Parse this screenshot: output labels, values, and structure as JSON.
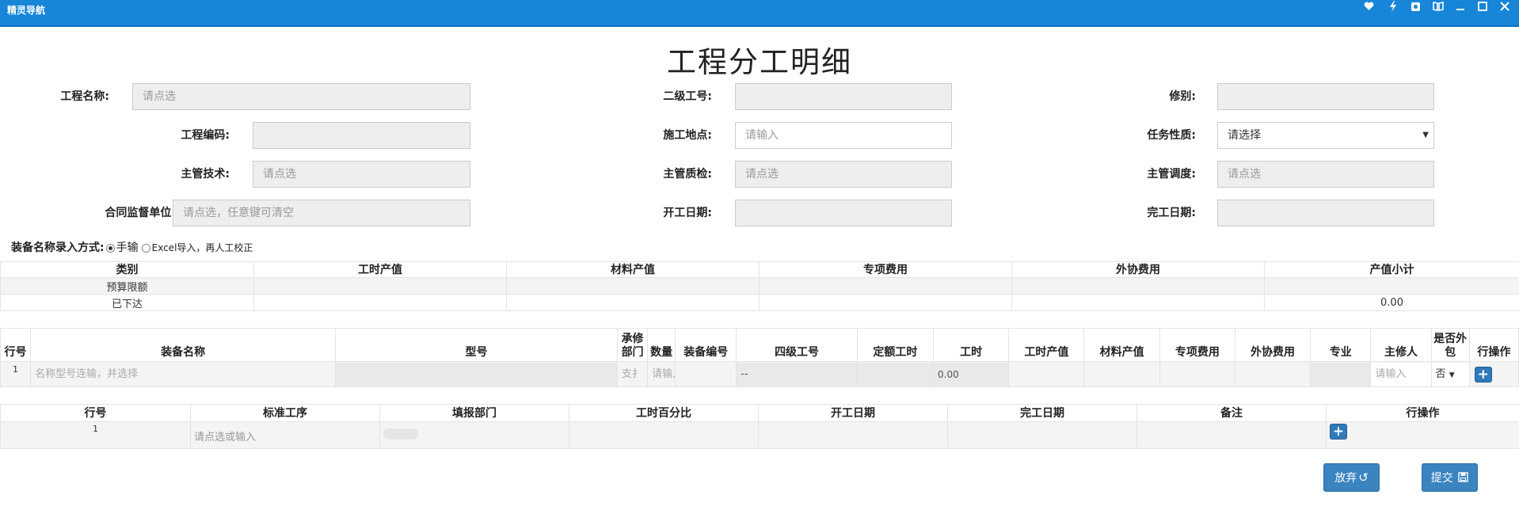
{
  "window": {
    "title": "精灵导航",
    "controls": [
      "heart-icon",
      "lightning-icon",
      "settings-icon",
      "book-icon",
      "minimize-icon",
      "maximize-icon",
      "close-icon"
    ]
  },
  "page_title": "工程分工明细",
  "form": {
    "project_name": {
      "label": "工程名称:",
      "placeholder": "请点选"
    },
    "project_code": {
      "label": "工程编码:",
      "value": ""
    },
    "chief_tech": {
      "label": "主管技术:",
      "placeholder": "请点选"
    },
    "contract_supervisor": {
      "label": "合同监督单位:",
      "placeholder": "请点选，任意键可清空"
    },
    "secondary_work_no": {
      "label": "二级工号:",
      "value": ""
    },
    "site": {
      "label": "施工地点:",
      "placeholder": "请输入"
    },
    "chief_qc": {
      "label": "主管质检:",
      "placeholder": "请点选"
    },
    "start_date": {
      "label": "开工日期:",
      "value": ""
    },
    "repair_type": {
      "label": "修别:",
      "value": ""
    },
    "task_nature": {
      "label": "任务性质:",
      "value": "请选择"
    },
    "chief_dispatch": {
      "label": "主管调度:",
      "placeholder": "请点选"
    },
    "end_date": {
      "label": "完工日期:",
      "value": ""
    }
  },
  "entry_mode": {
    "label": "装备名称录入方式:",
    "options": [
      "手输",
      "Excel导入，再人工校正"
    ],
    "selected": "手输"
  },
  "summary_table": {
    "headers": [
      "类别",
      "工时产值",
      "材料产值",
      "专项费用",
      "外协费用",
      "产值小计"
    ],
    "rows": [
      [
        "预算限额",
        "",
        "",
        "",
        "",
        ""
      ],
      [
        "已下达",
        "",
        "",
        "",
        "",
        "0.00"
      ]
    ]
  },
  "equipment_table": {
    "headers": [
      "行号",
      "装备名称",
      "型号",
      "承修部门",
      "数量",
      "装备编号",
      "四级工号",
      "定额工时",
      "工时",
      "工时产值",
      "材料产值",
      "专项费用",
      "外协费用",
      "专业",
      "主修人",
      "是否外包",
      "行操作"
    ],
    "row": {
      "num": "1",
      "name_placeholder": "名称型号连输，并选择",
      "model": "",
      "dept": "支扌",
      "qty_placeholder": "请输入",
      "equip_no": "",
      "level4": "--",
      "quota_hours": "",
      "hours": "0.00",
      "repairer_placeholder": "请输入",
      "outsourced": "否"
    },
    "add_label": "+"
  },
  "process_table": {
    "headers": [
      "行号",
      "标准工序",
      "填报部门",
      "工时百分比",
      "开工日期",
      "完工日期",
      "备注",
      "行操作"
    ],
    "row": {
      "num": "1",
      "process_placeholder": "请点选或输入"
    },
    "add_label": "+"
  },
  "buttons": {
    "abandon": "放弃",
    "submit": "提交"
  }
}
